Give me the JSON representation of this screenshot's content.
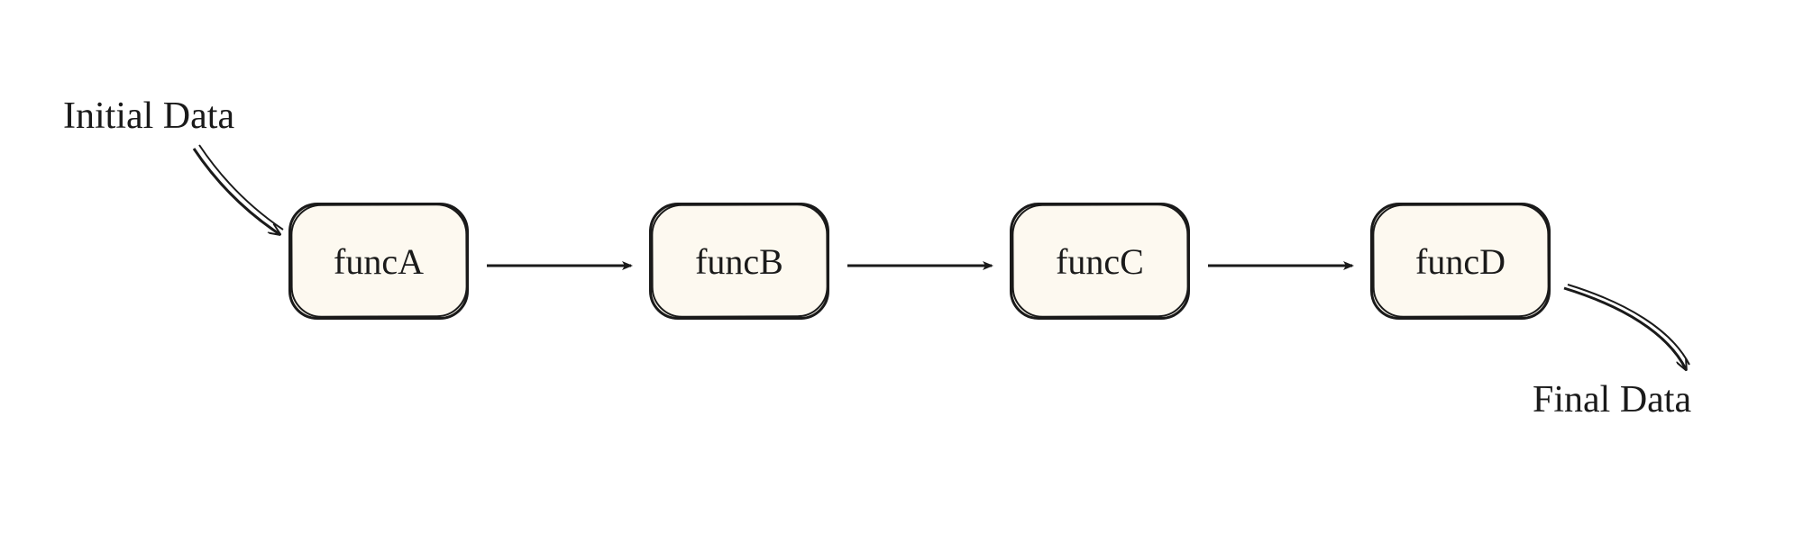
{
  "labels": {
    "initial": "Initial Data",
    "final": "Final Data"
  },
  "nodes": {
    "a": "funcA",
    "b": "funcB",
    "c": "funcC",
    "d": "funcD"
  }
}
